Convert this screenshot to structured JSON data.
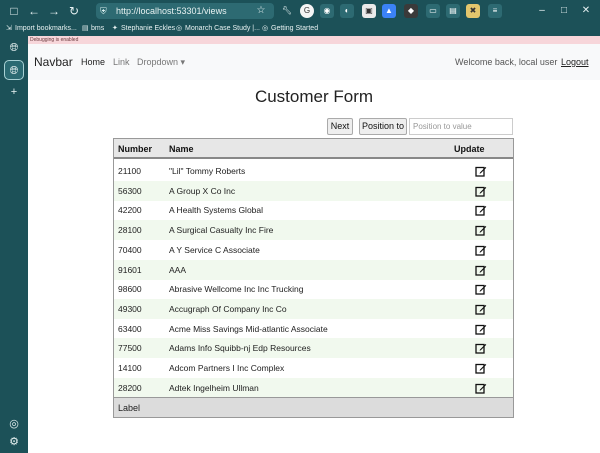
{
  "browser": {
    "url": "http://localhost:53301/views",
    "bookmarks": [
      "Import bookmarks...",
      "bms",
      "Stephanie Eckles",
      "Monarch Case Study |...",
      "Getting Started"
    ],
    "debug_banner": "Debugging is enabled"
  },
  "navbar": {
    "brand": "Navbar",
    "links": [
      "Home",
      "Link",
      "Dropdown"
    ],
    "welcome": "Welcome back, local user",
    "logout": "Logout"
  },
  "form": {
    "title": "Customer Form",
    "next_label": "Next",
    "position_label": "Position to",
    "position_placeholder": "Position to value"
  },
  "grid": {
    "columns": [
      "Number",
      "Name",
      "Update"
    ],
    "rows": [
      {
        "number": "21100",
        "name": "\"Lil\" Tommy Roberts"
      },
      {
        "number": "56300",
        "name": "A Group X Co Inc"
      },
      {
        "number": "42200",
        "name": "A Health Systems Global"
      },
      {
        "number": "28100",
        "name": "A Surgical Casualty Inc Fire"
      },
      {
        "number": "70400",
        "name": "A Y Service C Associate"
      },
      {
        "number": "91601",
        "name": "AAA"
      },
      {
        "number": "98600",
        "name": "Abrasive Wellcome Inc Inc Trucking"
      },
      {
        "number": "49300",
        "name": "Accugraph Of Company Inc Co"
      },
      {
        "number": "63400",
        "name": "Acme Miss Savings Mid-atlantic Associate"
      },
      {
        "number": "77500",
        "name": "Adams Info Squibb-nj Edp Resources"
      },
      {
        "number": "14100",
        "name": "Adcom Partners I Inc Complex"
      },
      {
        "number": "28200",
        "name": "Adtek Ingelheim Ullman"
      }
    ],
    "footer": "Label"
  },
  "colors": {
    "chrome": "#1c5158",
    "row_alt": "#f1f9ee",
    "header": "#e7e7e7"
  }
}
